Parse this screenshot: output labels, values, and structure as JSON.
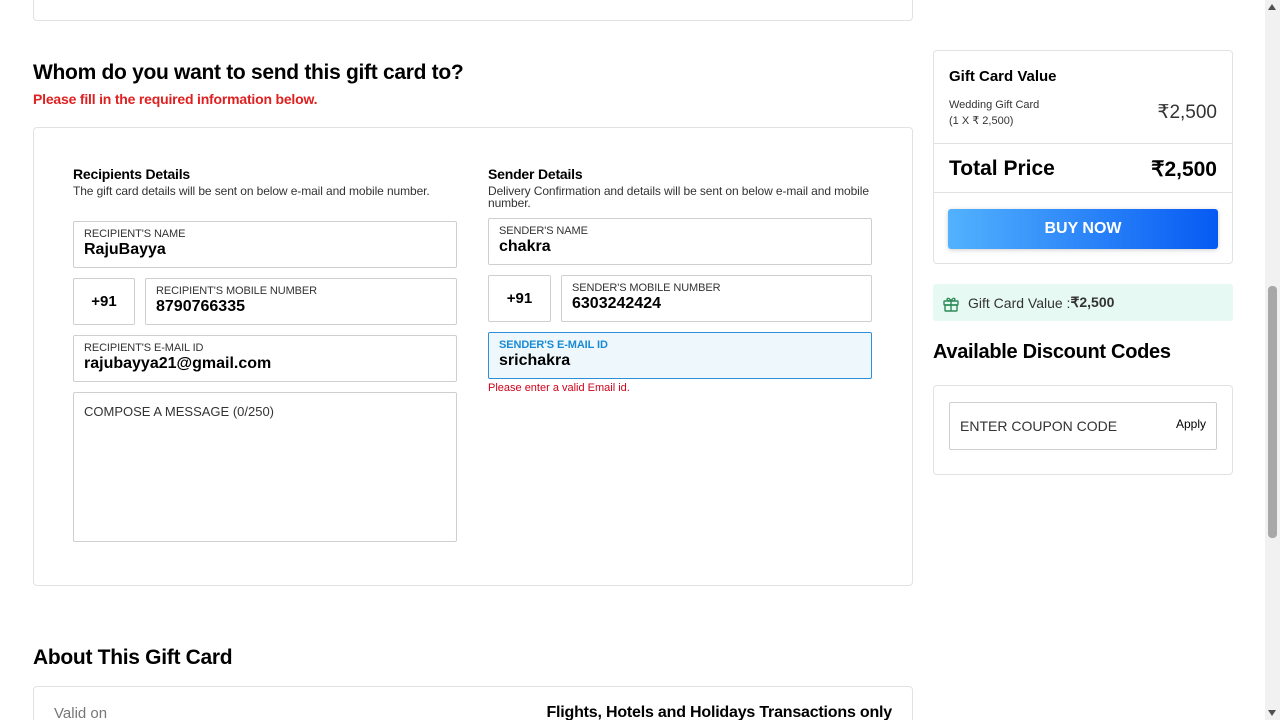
{
  "section": {
    "title": "Whom do you want to send this gift card to?",
    "subtitle": "Please fill in the required information below."
  },
  "recipient": {
    "heading": "Recipients Details",
    "description": "The gift card details will be sent on below e-mail and mobile number.",
    "name_label": "RECIPIENT'S NAME",
    "name_value": "RajuBayya",
    "country_code": "+91",
    "mobile_label": "RECIPIENT'S MOBILE NUMBER",
    "mobile_value": "8790766335",
    "email_label": "RECIPIENT'S E-MAIL ID",
    "email_value": "rajubayya21@gmail.com",
    "message_placeholder": "COMPOSE A MESSAGE (0/250)"
  },
  "sender": {
    "heading": "Sender Details",
    "description": "Delivery Confirmation and details will be sent on below e-mail and mobile number.",
    "name_label": "SENDER'S NAME",
    "name_value": "chakra",
    "country_code": "+91",
    "mobile_label": "SENDER'S MOBILE NUMBER",
    "mobile_value": "6303242424",
    "email_label": "SENDER'S E-MAIL ID",
    "email_value": "srichakra",
    "email_error": "Please enter a valid Email id."
  },
  "summary": {
    "title": "Gift Card Value",
    "item_name": "Wedding Gift Card",
    "item_qty": "(1 X ₹ 2,500)",
    "item_price": "₹2,500",
    "total_label": "Total Price",
    "total_value": "₹2,500",
    "buy_label": "BUY NOW"
  },
  "gift_value_banner": {
    "label": "Gift Card Value : ",
    "value": "₹2,500",
    "icon": "gift-icon"
  },
  "discount": {
    "title": "Available Discount Codes",
    "coupon_placeholder": "ENTER COUPON CODE",
    "apply_label": "Apply"
  },
  "about": {
    "title": "About This Gift Card",
    "valid_label": "Valid on",
    "valid_value": "Flights, Hotels and Holidays Transactions only"
  },
  "colors": {
    "error_red": "#e02020",
    "buy_gradient_start": "#53b2fe",
    "buy_gradient_end": "#065af3",
    "focus_blue": "#1a8ad4",
    "banner_green": "#e7f9f3"
  }
}
